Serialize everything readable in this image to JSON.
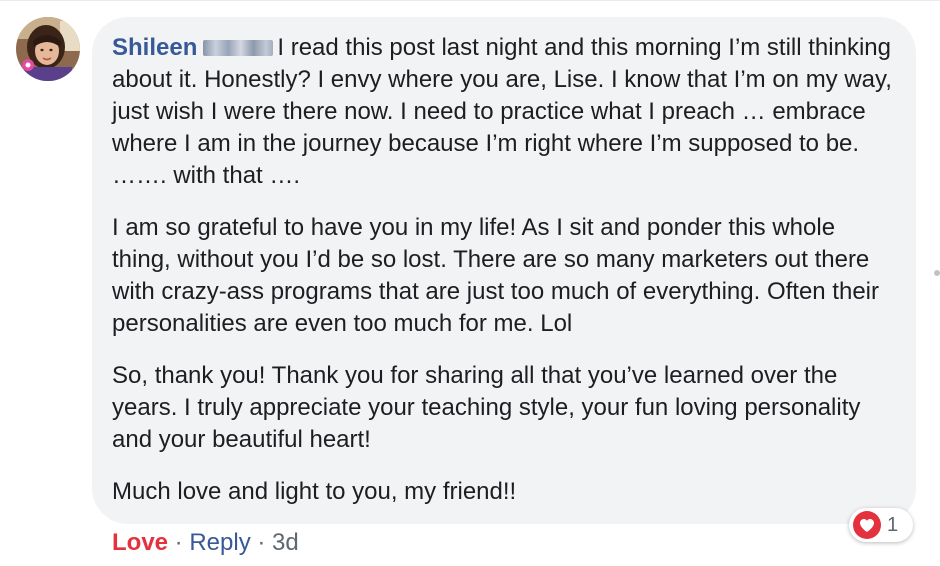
{
  "comment": {
    "author": "Shileen",
    "paragraphs": [
      "I read this post last night and this morning I’m still thinking about it. Honestly? I envy where you are, Lise. I know that I’m on my way, just wish I were there now. I need to practice what I preach … embrace where I am in the journey because I’m right where I’m supposed to be. ……. with that ….",
      "I am so grateful to have you in my life! As I sit and ponder this whole thing, without you I’d be so lost. There are so many marketers out there with crazy-ass programs that are just too much of everything. Often their personalities are even too much for me. Lol",
      "So, thank you! Thank you for sharing all that you’ve learned over the years. I truly appreciate your teaching style, your fun loving personality and your beautiful heart!",
      "Much love and light to you, my friend!!"
    ]
  },
  "reaction": {
    "icon": "heart-icon",
    "count": "1",
    "color": "#e4313d"
  },
  "actions": {
    "love": "Love",
    "separator1": " · ",
    "reply": "Reply",
    "separator2": " · ",
    "time": "3d"
  },
  "colors": {
    "name": "#385898",
    "bubble": "#f2f3f5",
    "love": "#e4313d",
    "meta": "#606770"
  }
}
